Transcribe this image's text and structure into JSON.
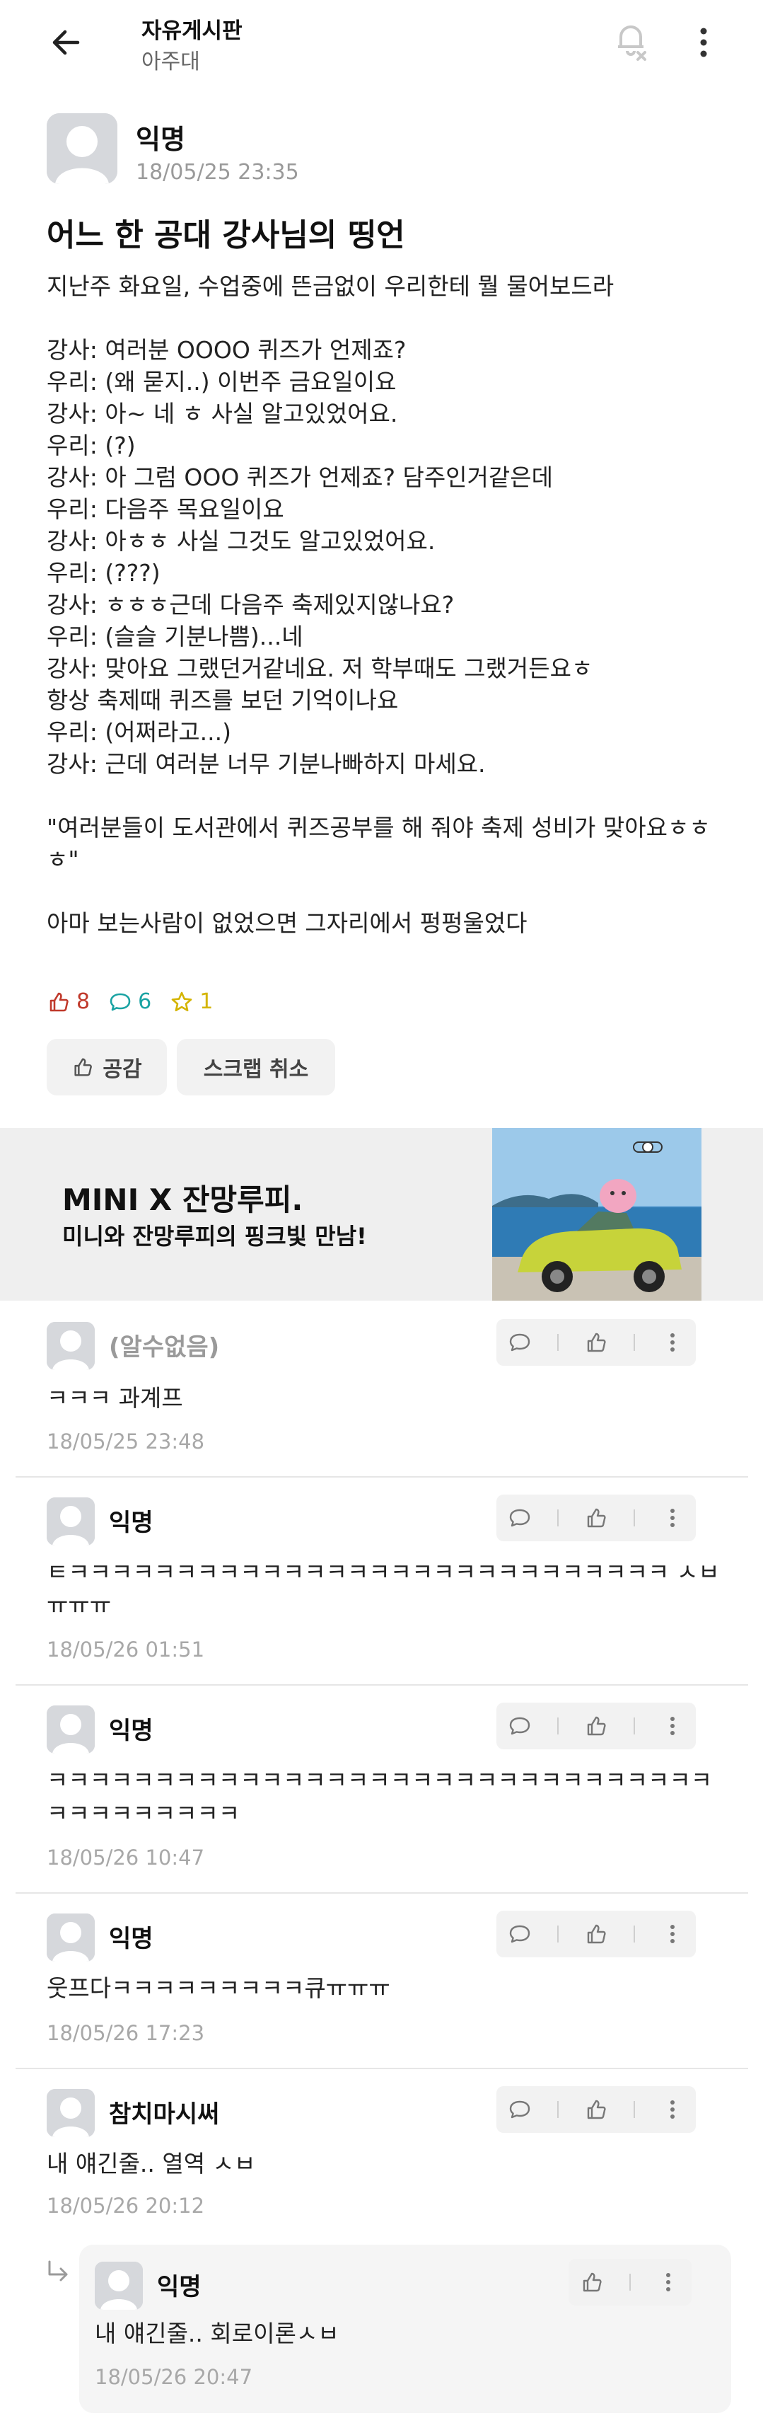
{
  "header": {
    "board_title": "자유게시판",
    "board_sub": "아주대"
  },
  "post": {
    "author": "익명",
    "time": "18/05/25 23:35",
    "title": "어느 한 공대 강사님의 띵언",
    "body": "지난주 화요일, 수업중에 뜬금없이 우리한테 뭘 물어보드라\n\n강사: 여러분 OOOO 퀴즈가 언제죠?\n우리: (왜 묻지..) 이번주 금요일이요\n강사: 아~ 네 ㅎ 사실 알고있었어요.\n우리: (?)\n강사: 아 그럼 OOO 퀴즈가 언제죠? 담주인거같은데\n우리: 다음주 목요일이요\n강사: 아ㅎㅎ 사실 그것도 알고있었어요.\n우리: (???)\n강사: ㅎㅎㅎ근데 다음주 축제있지않나요?\n우리: (슬슬 기분나쁨)...네\n강사: 맞아요 그랬던거같네요. 저 학부때도 그랬거든요ㅎ\n항상 축제때 퀴즈를 보던 기억이나요\n우리: (어쩌라고...)\n강사: 근데 여러분 너무 기분나빠하지 마세요.\n\n\"여러분들이 도서관에서 퀴즈공부를 해 줘야 축제 성비가 맞아요ㅎㅎㅎ\"\n\n아마 보는사람이 없었으면 그자리에서 펑펑울었다",
    "like_count": "8",
    "comment_count": "6",
    "scrap_count": "1",
    "like_button": "공감",
    "scrap_button": "스크랩 취소"
  },
  "ad": {
    "title": "MINI X 잔망루피.",
    "subtitle": "미니와 잔망루피의 핑크빛 만남!"
  },
  "comments": [
    {
      "author": "(알수없음)",
      "text": "ㅋㅋㅋ 과계프",
      "time": "18/05/25 23:48"
    },
    {
      "author": "익명",
      "text": "ㅌㅋㅋㅋㅋㅋㅋㅋㅋㅋㅋㅋㅋㅋㅋㅋㅋㅋㅋㅋㅋㅋㅋㅋㅋㅋㅋㅋㅋ ㅅㅂ ㅠㅠㅠ",
      "time": "18/05/26 01:51"
    },
    {
      "author": "익명",
      "text": "ㅋㅋㅋㅋㅋㅋㅋㅋㅋㅋㅋㅋㅋㅋㅋㅋㅋㅋㅋㅋㅋㅋㅋㅋㅋㅋㅋㅋㅋㅋㅋㅋㅋㅋㅋㅋㅋㅋㅋㅋ",
      "time": "18/05/26 10:47"
    },
    {
      "author": "익명",
      "text": "웃프다ㅋㅋㅋㅋㅋㅋㅋㅋㅋ큐ㅠㅠㅠ",
      "time": "18/05/26 17:23"
    },
    {
      "author": "참치마시써",
      "text": "내 얘긴줄.. 열역 ㅅㅂ",
      "time": "18/05/26 20:12"
    }
  ],
  "reply": {
    "author": "익명",
    "text": "내 얘긴줄.. 회로이론ㅅㅂ",
    "time": "18/05/26 20:47"
  }
}
